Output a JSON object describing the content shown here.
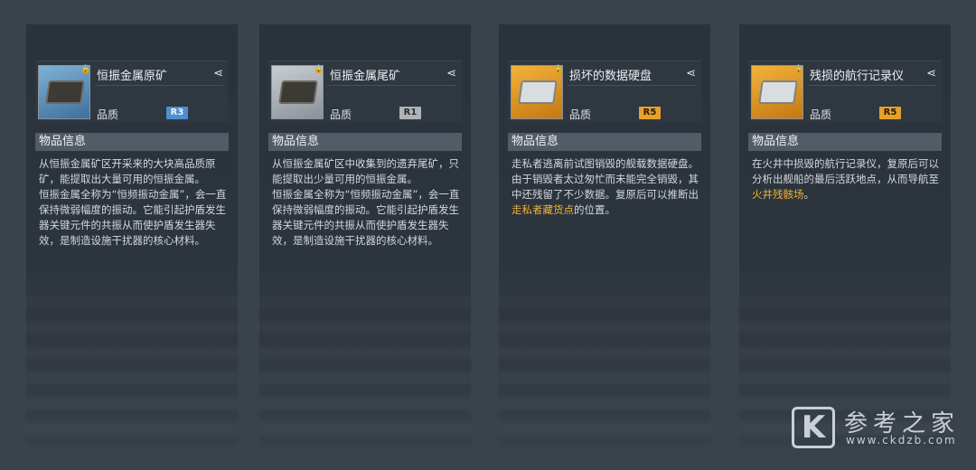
{
  "colors": {
    "background": "#3a424b",
    "card": "#2a323b",
    "highlight": "#f0b23a",
    "badge_r3": "#4d8fcf",
    "badge_r1": "#aeb3b8",
    "badge_r5": "#e6a12a"
  },
  "cards": [
    {
      "name": "恒振金属原矿",
      "quality_label": "品质",
      "rarity": "R3",
      "thumb_icon": "metal-ore-icon",
      "info_title": "物品信息",
      "desc_lines": [
        "从恒振金属矿区开采来的大块高品质原矿，能提取出大量可用的恒振金属。",
        "恒振金属全称为“恒频振动金属”，会一直保持微弱幅度的振动。它能引起护盾发生器关键元件的共振从而使护盾发生器失效，是制造设施干扰器的核心材料。"
      ]
    },
    {
      "name": "恒振金属尾矿",
      "quality_label": "品质",
      "rarity": "R1",
      "thumb_icon": "metal-tailings-icon",
      "info_title": "物品信息",
      "desc_lines": [
        "从恒振金属矿区中收集到的遗弃尾矿，只能提取出少量可用的恒振金属。",
        "恒振金属全称为“恒频振动金属”，会一直保持微弱幅度的振动。它能引起护盾发生器关键元件的共振从而使护盾发生器失效，是制造设施干扰器的核心材料。"
      ]
    },
    {
      "name": "损坏的数据硬盘",
      "quality_label": "品质",
      "rarity": "R5",
      "thumb_icon": "data-drive-icon",
      "info_title": "物品信息",
      "desc_before": "走私者逃离前试图销毁的舰载数据硬盘。由于销毁者太过匆忙而未能完全销毁，其中还残留了不少数据。复原后可以推断出",
      "desc_highlight": "走私者藏货点",
      "desc_after": "的位置。"
    },
    {
      "name": "残损的航行记录仪",
      "quality_label": "品质",
      "rarity": "R5",
      "thumb_icon": "flight-recorder-icon",
      "info_title": "物品信息",
      "desc_before": "在火井中损毁的航行记录仪，复原后可以分析出舰船的最后活跃地点，从而导航至",
      "desc_highlight": "火井残骸场",
      "desc_after": "。"
    }
  ],
  "watermark": {
    "logo": "K",
    "title": "参考之家",
    "url": "www.ckdzb.com"
  }
}
